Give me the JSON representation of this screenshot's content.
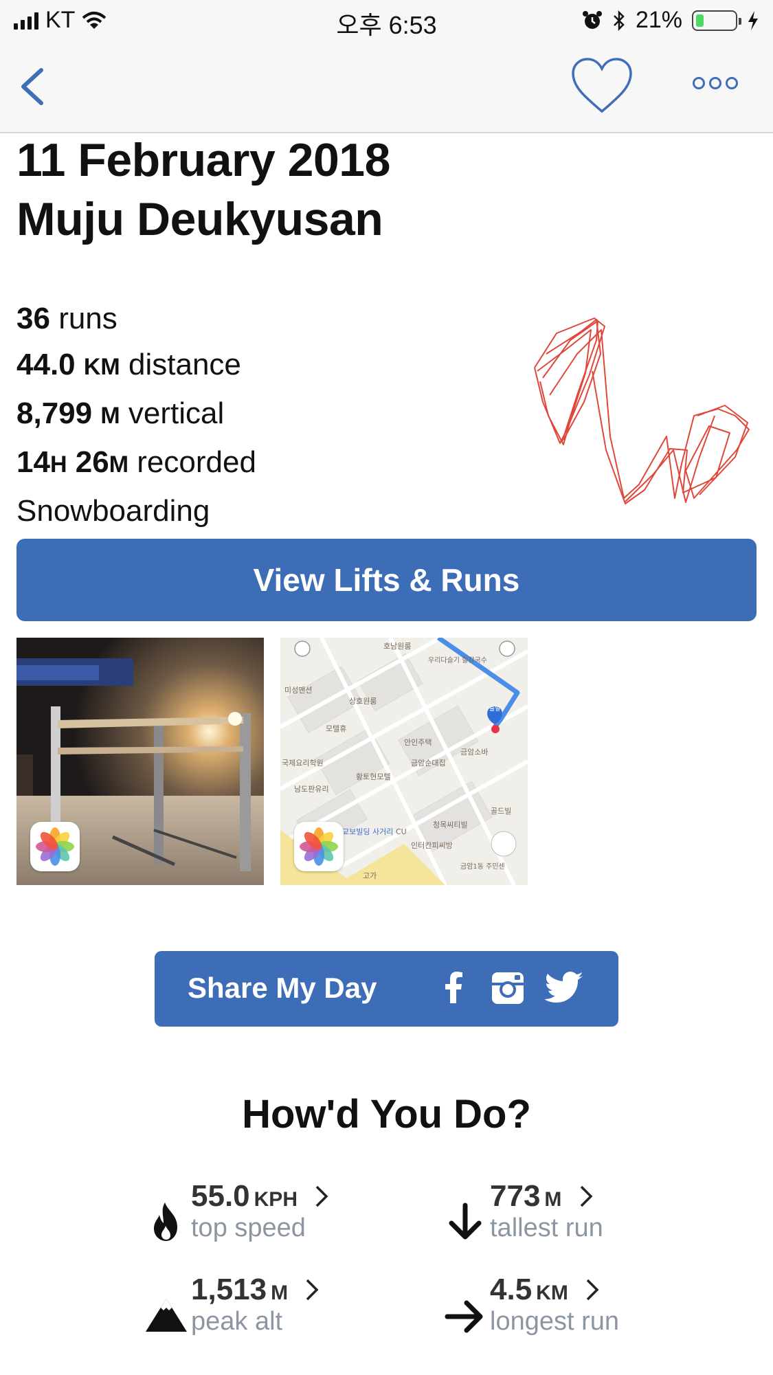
{
  "status_bar": {
    "carrier": "KT",
    "time": "오후 6:53",
    "battery": "21%",
    "battery_level": 0.21
  },
  "nav": {
    "back_icon": "chevron-left-icon",
    "favorite_icon": "heart-icon",
    "more_icon": "more-dots-icon",
    "accent_color": "#3f6db8"
  },
  "title": {
    "date": "11 February 2018",
    "resort": "Muju Deukyusan"
  },
  "stats": {
    "runs_value": "36",
    "runs_label": "runs",
    "distance_value": "44.0",
    "distance_unit": "KM",
    "distance_label": "distance",
    "vertical_value": "8,799",
    "vertical_unit": "M",
    "vertical_label": "vertical",
    "hours_value": "14",
    "hours_unit": "H",
    "minutes_value": "26",
    "minutes_unit": "M",
    "recorded_label": "recorded",
    "sport": "Snowboarding"
  },
  "track_color": "#e0473a",
  "actions": {
    "view_lifts_runs": "View Lifts & Runs",
    "button_color": "#3e6db8"
  },
  "media": {
    "map_labels": [
      "호남원룸",
      "우리다슬기 할칼국수",
      "미성맨션",
      "상호원룸",
      "모텔휴",
      "안인주택",
      "금암소바",
      "금암순대집",
      "국제요리학원",
      "황토현모텔",
      "남도판유리",
      "출발",
      "교보빌딩 사거리",
      "CU",
      "청목씨티빌",
      "인터칸피씨방",
      "골드빌",
      "고가",
      "금암1동 주민센"
    ]
  },
  "share": {
    "label": "Share My Day",
    "icons": [
      "facebook-icon",
      "instagram-icon",
      "twitter-icon"
    ]
  },
  "performance": {
    "heading": "How'd You Do?",
    "metrics": [
      {
        "value": "55.0",
        "unit": "KPH",
        "label": "top speed",
        "icon": "flame-icon"
      },
      {
        "value": "773",
        "unit": "M",
        "label": "tallest run",
        "icon": "arrow-down-icon"
      },
      {
        "value": "1,513",
        "unit": "M",
        "label": "peak alt",
        "icon": "mountain-icon"
      },
      {
        "value": "4.5",
        "unit": "KM",
        "label": "longest run",
        "icon": "arrow-right-icon"
      }
    ]
  }
}
